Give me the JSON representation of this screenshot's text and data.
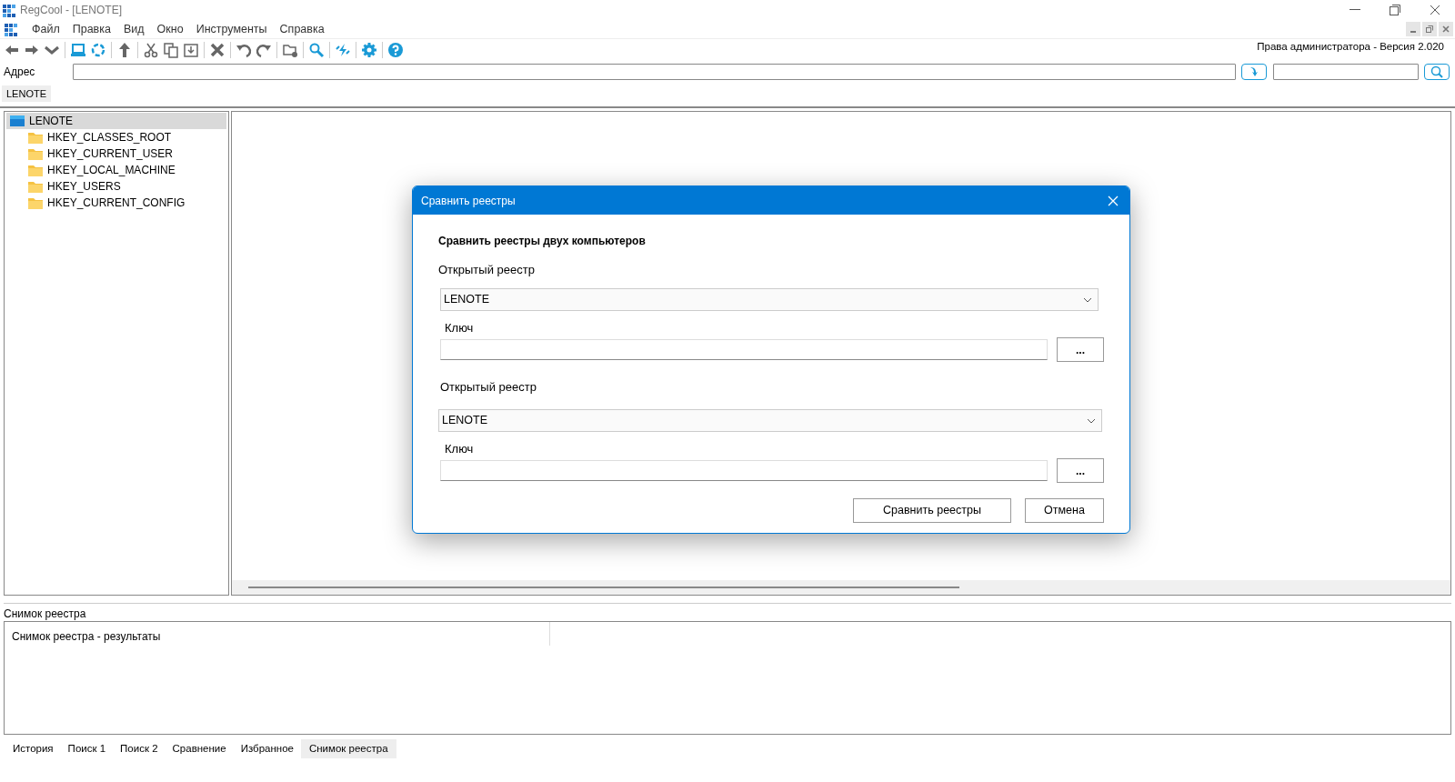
{
  "window": {
    "title": "RegCool - [LENOTE]"
  },
  "menu": [
    "Файл",
    "Правка",
    "Вид",
    "Окно",
    "Инструменты",
    "Справка"
  ],
  "admin_label": "Права администратора - Версия 2.020",
  "address": {
    "label": "Адрес"
  },
  "computer_tabs": [
    {
      "label": "LENOTE",
      "selected": true
    }
  ],
  "tree": {
    "label": "LENOTE",
    "selected": true,
    "children": [
      {
        "label": "HKEY_CLASSES_ROOT",
        "selected": false
      },
      {
        "label": "HKEY_CURRENT_USER",
        "selected": false
      },
      {
        "label": "HKEY_LOCAL_MACHINE",
        "selected": false
      },
      {
        "label": "HKEY_USERS",
        "selected": false
      },
      {
        "label": "HKEY_CURRENT_CONFIG",
        "selected": false
      }
    ]
  },
  "bottom_panel": {
    "title": "Снимок реестра",
    "column_1": "Снимок реестра - результаты"
  },
  "bottom_tabs": [
    {
      "label": "История",
      "selected": false
    },
    {
      "label": "Поиск 1",
      "selected": false
    },
    {
      "label": "Поиск 2",
      "selected": false
    },
    {
      "label": "Сравнение",
      "selected": false
    },
    {
      "label": "Избранное",
      "selected": false
    },
    {
      "label": "Снимок реестра",
      "selected": true
    }
  ],
  "dialog": {
    "title": "Сравнить реестры",
    "heading": "Сравнить реестры двух компьютеров",
    "sections": [
      {
        "registry_label": "Открытый реестр",
        "registry_value": "LENOTE",
        "key_label": "Ключ",
        "browse_button": "..."
      },
      {
        "registry_label": "Открытый реестр",
        "registry_value": "LENOTE",
        "key_label": "Ключ",
        "browse_button": "..."
      }
    ],
    "buttons": [
      "Сравнить реестры",
      "Отмена"
    ]
  }
}
